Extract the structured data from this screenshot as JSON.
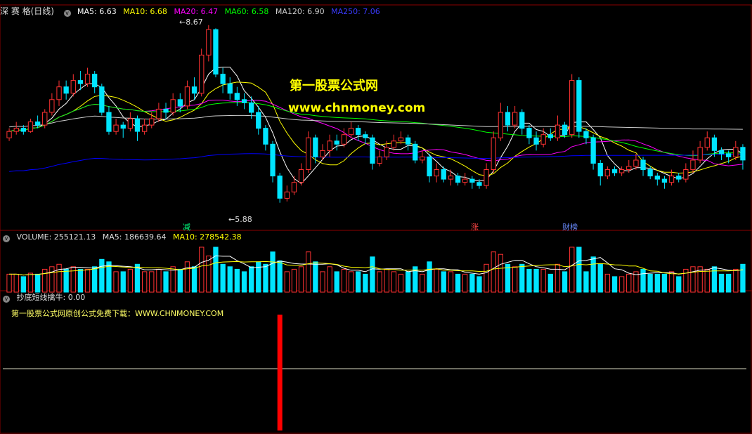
{
  "price_header": {
    "stock": "深 赛 格(日线)",
    "ma5": "MA5: 6.63",
    "ma10": "MA10: 6.68",
    "ma20": "MA20: 6.47",
    "ma60": "MA60: 6.58",
    "ma120": "MA120: 6.90",
    "ma250": "MA250: 7.06"
  },
  "annotations": {
    "high": "8.67",
    "low": "5.88"
  },
  "event_tags": [
    "减",
    "涨",
    "财榜"
  ],
  "watermark": {
    "line1": "第一股票公式网",
    "line2": "www.chnmoney.com"
  },
  "volume_header": {
    "volume": "VOLUME: 255121.13",
    "ma5": "MA5: 186639.64",
    "ma10": "MA10: 278542.38"
  },
  "indicator_header": {
    "name": "抄底短线擒牛",
    "value": ": 0.00"
  },
  "indicator_note": "第一股票公式网原创公式免费下载：WWW.CHNMONEY.COM",
  "colors": {
    "up": "#ff3232",
    "down": "#00e5ff",
    "ma5": "#ffffff",
    "ma10": "#ffff00",
    "ma20": "#ff00ff",
    "ma60": "#00ff00",
    "ma120": "#cccccc",
    "ma250": "#0000ff",
    "signal": "#ff0000",
    "grid": "#8b0000"
  },
  "chart_data": {
    "type": "candlestick",
    "ylim": [
      5.7,
      8.8
    ],
    "candles": [
      [
        6.9,
        7.0,
        7.05,
        6.85
      ],
      [
        7.0,
        7.05,
        7.15,
        6.95
      ],
      [
        7.05,
        7.0,
        7.1,
        6.95
      ],
      [
        7.0,
        7.15,
        7.2,
        6.98
      ],
      [
        7.15,
        7.1,
        7.25,
        7.05
      ],
      [
        7.1,
        7.3,
        7.35,
        7.05
      ],
      [
        7.3,
        7.5,
        7.6,
        7.25
      ],
      [
        7.5,
        7.7,
        7.8,
        7.4
      ],
      [
        7.7,
        7.6,
        7.8,
        7.5
      ],
      [
        7.6,
        7.8,
        7.9,
        7.55
      ],
      [
        7.8,
        7.75,
        7.95,
        7.65
      ],
      [
        7.75,
        7.9,
        8.0,
        7.7
      ],
      [
        7.9,
        7.7,
        7.95,
        7.6
      ],
      [
        7.7,
        7.3,
        7.75,
        7.25
      ],
      [
        7.3,
        7.0,
        7.4,
        6.95
      ],
      [
        7.0,
        7.1,
        7.2,
        6.95
      ],
      [
        7.1,
        7.05,
        7.15,
        6.9
      ],
      [
        7.05,
        7.2,
        7.3,
        7.0
      ],
      [
        7.2,
        7.0,
        7.25,
        6.85
      ],
      [
        7.0,
        7.1,
        7.2,
        6.95
      ],
      [
        7.1,
        7.2,
        7.3,
        7.05
      ],
      [
        7.2,
        7.35,
        7.45,
        7.15
      ],
      [
        7.35,
        7.3,
        7.45,
        7.2
      ],
      [
        7.3,
        7.5,
        7.6,
        7.25
      ],
      [
        7.5,
        7.4,
        7.6,
        7.3
      ],
      [
        7.4,
        7.7,
        7.8,
        7.35
      ],
      [
        7.7,
        7.6,
        7.85,
        7.5
      ],
      [
        7.6,
        8.2,
        8.3,
        7.55
      ],
      [
        8.2,
        8.6,
        8.67,
        8.1
      ],
      [
        8.6,
        7.9,
        8.62,
        7.85
      ],
      [
        7.9,
        7.75,
        8.0,
        7.6
      ],
      [
        7.75,
        7.6,
        7.85,
        7.5
      ],
      [
        7.6,
        7.5,
        7.7,
        7.4
      ],
      [
        7.5,
        7.45,
        7.6,
        7.35
      ],
      [
        7.45,
        7.3,
        7.55,
        7.2
      ],
      [
        7.3,
        7.05,
        7.4,
        6.95
      ],
      [
        7.05,
        6.8,
        7.1,
        6.7
      ],
      [
        6.8,
        6.3,
        6.85,
        6.2
      ],
      [
        6.3,
        5.95,
        6.35,
        5.88
      ],
      [
        5.95,
        6.05,
        6.15,
        5.9
      ],
      [
        6.05,
        6.2,
        6.3,
        6.0
      ],
      [
        6.2,
        6.4,
        6.5,
        6.15
      ],
      [
        6.4,
        6.9,
        7.0,
        6.35
      ],
      [
        6.9,
        6.6,
        6.95,
        6.5
      ],
      [
        6.6,
        6.7,
        6.8,
        6.55
      ],
      [
        6.7,
        6.85,
        6.95,
        6.6
      ],
      [
        6.85,
        6.8,
        6.95,
        6.7
      ],
      [
        6.8,
        6.95,
        7.05,
        6.75
      ],
      [
        6.95,
        7.05,
        7.15,
        6.9
      ],
      [
        7.05,
        6.95,
        7.1,
        6.85
      ],
      [
        6.95,
        6.9,
        7.0,
        6.8
      ],
      [
        6.9,
        6.5,
        6.95,
        6.4
      ],
      [
        6.5,
        6.6,
        6.7,
        6.45
      ],
      [
        6.6,
        6.75,
        6.85,
        6.55
      ],
      [
        6.75,
        6.85,
        6.95,
        6.7
      ],
      [
        6.85,
        6.9,
        7.0,
        6.8
      ],
      [
        6.9,
        6.8,
        6.95,
        6.7
      ],
      [
        6.8,
        6.55,
        6.85,
        6.5
      ],
      [
        6.55,
        6.6,
        6.7,
        6.5
      ],
      [
        6.6,
        6.3,
        6.65,
        6.2
      ],
      [
        6.3,
        6.4,
        6.5,
        6.2
      ],
      [
        6.4,
        6.25,
        6.45,
        6.2
      ],
      [
        6.25,
        6.3,
        6.4,
        6.15
      ],
      [
        6.3,
        6.2,
        6.35,
        6.15
      ],
      [
        6.2,
        6.25,
        6.35,
        6.15
      ],
      [
        6.25,
        6.2,
        6.3,
        6.1
      ],
      [
        6.2,
        6.15,
        6.25,
        6.1
      ],
      [
        6.15,
        6.4,
        6.5,
        6.1
      ],
      [
        6.4,
        6.9,
        7.0,
        6.35
      ],
      [
        6.9,
        7.3,
        7.45,
        6.85
      ],
      [
        7.3,
        7.1,
        7.4,
        7.0
      ],
      [
        7.1,
        7.3,
        7.4,
        7.05
      ],
      [
        7.3,
        7.05,
        7.35,
        6.95
      ],
      [
        7.05,
        6.9,
        7.1,
        6.8
      ],
      [
        6.9,
        6.8,
        7.0,
        6.7
      ],
      [
        6.8,
        6.95,
        7.05,
        6.75
      ],
      [
        6.95,
        6.9,
        7.05,
        6.85
      ],
      [
        6.9,
        7.1,
        7.25,
        6.85
      ],
      [
        7.1,
        6.95,
        7.15,
        6.9
      ],
      [
        6.95,
        7.8,
        7.9,
        6.9
      ],
      [
        7.8,
        7.0,
        7.85,
        6.9
      ],
      [
        7.0,
        6.9,
        7.05,
        6.8
      ],
      [
        6.9,
        6.5,
        6.95,
        6.4
      ],
      [
        6.5,
        6.3,
        6.55,
        6.15
      ],
      [
        6.3,
        6.4,
        6.45,
        6.25
      ],
      [
        6.4,
        6.35,
        6.45,
        6.3
      ],
      [
        6.35,
        6.4,
        6.45,
        6.3
      ],
      [
        6.4,
        6.45,
        6.55,
        6.35
      ],
      [
        6.45,
        6.55,
        6.65,
        6.4
      ],
      [
        6.55,
        6.4,
        6.6,
        6.3
      ],
      [
        6.4,
        6.3,
        6.45,
        6.25
      ],
      [
        6.3,
        6.25,
        6.35,
        6.15
      ],
      [
        6.25,
        6.2,
        6.3,
        6.1
      ],
      [
        6.2,
        6.3,
        6.4,
        6.15
      ],
      [
        6.3,
        6.25,
        6.35,
        6.2
      ],
      [
        6.25,
        6.4,
        6.5,
        6.2
      ],
      [
        6.4,
        6.55,
        6.7,
        6.35
      ],
      [
        6.55,
        6.75,
        6.85,
        6.5
      ],
      [
        6.75,
        6.9,
        7.0,
        6.7
      ],
      [
        6.9,
        6.7,
        6.95,
        6.6
      ],
      [
        6.7,
        6.65,
        6.75,
        6.55
      ],
      [
        6.65,
        6.6,
        6.7,
        6.5
      ],
      [
        6.6,
        6.75,
        6.85,
        6.55
      ],
      [
        6.75,
        6.55,
        6.8,
        6.4
      ]
    ],
    "volume_ylim": [
      0,
      1
    ],
    "signal_index": 38
  }
}
